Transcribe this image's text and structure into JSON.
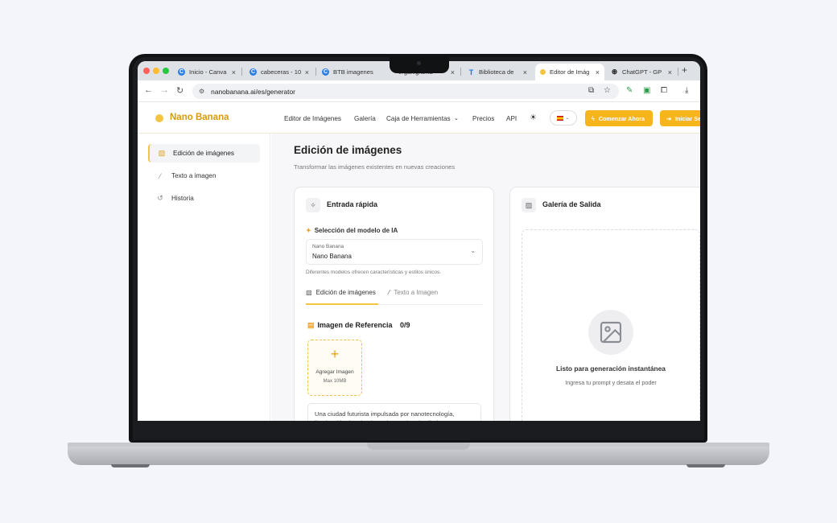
{
  "browser": {
    "tabs": [
      {
        "label": "Inicio - Canva",
        "fav_color": "#2b7ee4"
      },
      {
        "label": "cabeceras - 10",
        "fav_color": "#2b7ee4"
      },
      {
        "label": "BTB imagenes",
        "fav_color": "#2b7ee4"
      },
      {
        "label": "organigrama",
        "fav_color": "#6b6b6b"
      },
      {
        "label": "Biblioteca de",
        "fav_color": "#1a73e8"
      },
      {
        "label": "Editor de Imág",
        "fav_color": "#f4c542"
      },
      {
        "label": "ChatGPT - GP",
        "fav_color": "#222222"
      }
    ],
    "url": "nanobanana.ai/es/generator"
  },
  "nav": {
    "brand": "Nano Banana",
    "links": [
      "Editor de Imágenes",
      "Galería",
      "Caja de Herramientas",
      "Precios",
      "API"
    ],
    "cta_primary": "Comenzar Ahora",
    "cta_secondary": "Iniciar Sesión",
    "accent": "#f6b51a"
  },
  "sidebar": {
    "items": [
      {
        "label": "Edición de imágenes",
        "icon": "image-edit-icon"
      },
      {
        "label": "Texto a imagen",
        "icon": "magic-wand-icon"
      },
      {
        "label": "Historia",
        "icon": "history-icon"
      }
    ]
  },
  "page": {
    "title": "Edición de imágenes",
    "subtitle": "Transformar las imágenes existentes en nuevas creaciones"
  },
  "input_card": {
    "title": "Entrada rápida",
    "model_label": "Selección del modelo de IA",
    "model_small": "Nano Banana",
    "model_value": "Nano Banana",
    "model_help": "Diferentes modelos ofrecen características y estilos únicos.",
    "tabs": [
      "Edición de imágenes",
      "Texto a Imagen"
    ],
    "ref_title": "Imagen de Referencia",
    "ref_count": "0/9",
    "add_label": "Agregar Imagen",
    "add_max": "Max 10MB",
    "prompt": "Una ciudad futurista impulsada por nanotecnología, iluminación dorada al atardecer, ultra detallada..."
  },
  "output_card": {
    "title": "Galería de Salida",
    "empty_title": "Listo para generación instantánea",
    "empty_sub": "Ingresa tu prompt y desata el poder"
  }
}
